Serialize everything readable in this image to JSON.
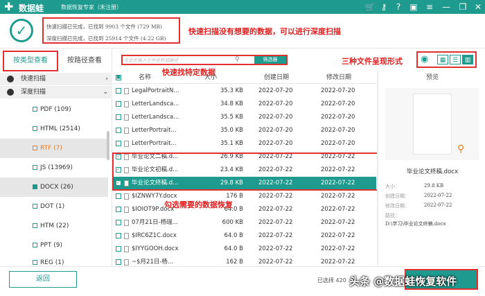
{
  "titlebar": {
    "app_name": "数据蛙",
    "subtitle": "数据恢复专家（未注册）"
  },
  "header": {
    "quick_scan_status": "快速扫描已完成，已找到 9903 个文件 (729 MB)",
    "deep_scan_status": "深度扫描已完成，已找到 25914 个文件 (4.22 GB)"
  },
  "annotations": {
    "scan": "快速扫描没有想要的数据，可以进行深度扫描",
    "find": "快速找特定数据",
    "views": "三种文件呈现形式",
    "select": "勾选需要的数据恢复"
  },
  "left_panel": {
    "tabs": [
      "按类型查看",
      "按路径查看"
    ],
    "quick_scan": "快速扫描",
    "deep_scan": "深度扫描",
    "file_types": [
      {
        "label": "PDF (109)",
        "state": "normal"
      },
      {
        "label": "HTML (2514)",
        "state": "normal"
      },
      {
        "label": "RTF (7)",
        "state": "partial"
      },
      {
        "label": "JS (13969)",
        "state": "normal"
      },
      {
        "label": "DOCX (26)",
        "state": "checked"
      },
      {
        "label": "DOT (1)",
        "state": "normal"
      },
      {
        "label": "HTM (22)",
        "state": "normal"
      },
      {
        "label": "PPT (9)",
        "state": "normal"
      },
      {
        "label": "REG (1)",
        "state": "normal"
      }
    ]
  },
  "search": {
    "placeholder": "在此处输入文件名称或路径",
    "filter_label": "筛选器"
  },
  "table": {
    "headers": {
      "name": "名称",
      "size": "大小",
      "created": "创建日期",
      "modified": "修改日期"
    },
    "rows": [
      {
        "name": "LegalPortraitN...",
        "size": "35.3 KB",
        "created": "2022-07-20",
        "modified": "2022-07-20",
        "checked": false
      },
      {
        "name": "LetterLandsca...",
        "size": "34.8 KB",
        "created": "2022-07-20",
        "modified": "2022-07-20",
        "checked": false
      },
      {
        "name": "LetterLandsca...",
        "size": "35.5 KB",
        "created": "2022-07-20",
        "modified": "2022-07-20",
        "checked": false
      },
      {
        "name": "LetterPortrait...",
        "size": "35.0 KB",
        "created": "2022-07-20",
        "modified": "2022-07-20",
        "checked": false
      },
      {
        "name": "LetterPortrait...",
        "size": "35.1 KB",
        "created": "2022-07-20",
        "modified": "2022-07-20",
        "checked": false
      },
      {
        "name": "毕业论文二稿.d...",
        "size": "26.9 KB",
        "created": "2022-07-22",
        "modified": "2022-07-22",
        "checked": true
      },
      {
        "name": "毕业论文初稿.d...",
        "size": "23.4 KB",
        "created": "2022-07-22",
        "modified": "2022-07-22",
        "checked": true
      },
      {
        "name": "毕业论文终稿.d...",
        "size": "29.8 KB",
        "created": "2022-07-22",
        "modified": "2022-07-22",
        "checked": true
      },
      {
        "name": "$IZNWY7Y.docx",
        "size": "176 B",
        "created": "2022-07-22",
        "modified": "2022-07-22",
        "checked": false
      },
      {
        "name": "$IOIOT9P.docx",
        "size": "64.0 B",
        "created": "2022-07-22",
        "modified": "2022-07-22",
        "checked": false
      },
      {
        "name": "07月21日-杨瑞...",
        "size": "600 KB",
        "created": "2022-07-22",
        "modified": "2022-07-22",
        "checked": false
      },
      {
        "name": "$IRC6Z1C.docx",
        "size": "64.0 B",
        "created": "2022-07-22",
        "modified": "2022-07-22",
        "checked": false
      },
      {
        "name": "$IYYGOOH.docx",
        "size": "64.0 B",
        "created": "2022-07-22",
        "modified": "2022-07-22",
        "checked": false
      },
      {
        "name": "~$月21日-杨...",
        "size": "162 B",
        "created": "2022-07-22",
        "modified": "2022-07-22",
        "checked": false
      }
    ]
  },
  "preview": {
    "title": "预览",
    "file_name": "毕业论文终稿.docx",
    "size_label": "大小：",
    "size": "29.8 KB",
    "created_label": "创建日期：",
    "created": "2022-07-22",
    "modified_label": "修改日期：",
    "modified": "2022-07-22",
    "path_label": "路径：",
    "path": "D:\\学习\\毕业论文终稿.docx"
  },
  "bottom": {
    "back_label": "返回",
    "selected_text": "已选择 420",
    "watermark": "头条 @数据蛙恢复软件"
  }
}
